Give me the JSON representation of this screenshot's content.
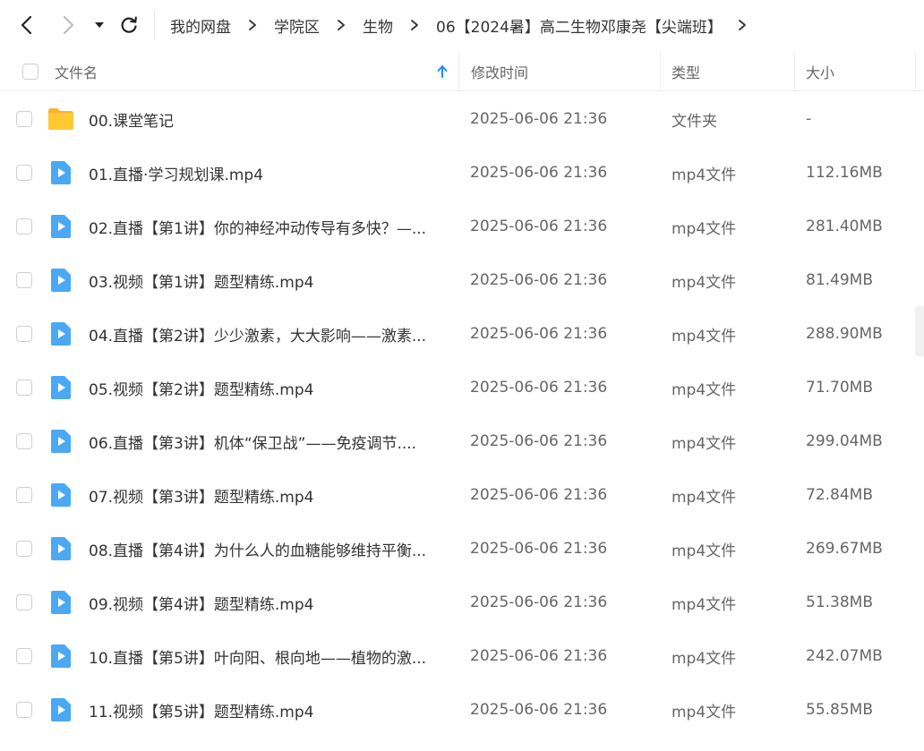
{
  "nav": {
    "back_icon": "chevron-left-icon",
    "forward_icon": "chevron-right-icon",
    "dropdown_icon": "caret-down-icon",
    "refresh_icon": "refresh-icon"
  },
  "breadcrumb": [
    "我的网盘",
    "学院区",
    "生物",
    "06【2024暑】高二生物邓康尧【尖端班】"
  ],
  "columns": {
    "name": "文件名",
    "mtime": "修改时间",
    "type": "类型",
    "size": "大小"
  },
  "sort_indicator_icon": "arrow-up-icon",
  "colors": {
    "accent": "#1a8cff",
    "folder": "#ffc933",
    "video_icon": "#4aa8f5"
  },
  "files": [
    {
      "icon": "folder-icon",
      "name": "00.课堂笔记",
      "mtime": "2025-06-06 21:36",
      "type": "文件夹",
      "size": "-"
    },
    {
      "icon": "video-file-icon",
      "name": "01.直播·学习规划课.mp4",
      "mtime": "2025-06-06 21:36",
      "type": "mp4文件",
      "size": "112.16MB"
    },
    {
      "icon": "video-file-icon",
      "name": "02.直播【第1讲】你的神经冲动传导有多快？—...",
      "mtime": "2025-06-06 21:36",
      "type": "mp4文件",
      "size": "281.40MB"
    },
    {
      "icon": "video-file-icon",
      "name": "03.视频【第1讲】题型精练.mp4",
      "mtime": "2025-06-06 21:36",
      "type": "mp4文件",
      "size": "81.49MB"
    },
    {
      "icon": "video-file-icon",
      "name": "04.直播【第2讲】少少激素，大大影响——激素...",
      "mtime": "2025-06-06 21:36",
      "type": "mp4文件",
      "size": "288.90MB"
    },
    {
      "icon": "video-file-icon",
      "name": "05.视频【第2讲】题型精练.mp4",
      "mtime": "2025-06-06 21:36",
      "type": "mp4文件",
      "size": "71.70MB"
    },
    {
      "icon": "video-file-icon",
      "name": "06.直播【第3讲】机体“保卫战”——免疫调节....",
      "mtime": "2025-06-06 21:36",
      "type": "mp4文件",
      "size": "299.04MB"
    },
    {
      "icon": "video-file-icon",
      "name": "07.视频【第3讲】题型精练.mp4",
      "mtime": "2025-06-06 21:36",
      "type": "mp4文件",
      "size": "72.84MB"
    },
    {
      "icon": "video-file-icon",
      "name": "08.直播【第4讲】为什么人的血糖能够维持平衡...",
      "mtime": "2025-06-06 21:36",
      "type": "mp4文件",
      "size": "269.67MB"
    },
    {
      "icon": "video-file-icon",
      "name": "09.视频【第4讲】题型精练.mp4",
      "mtime": "2025-06-06 21:36",
      "type": "mp4文件",
      "size": "51.38MB"
    },
    {
      "icon": "video-file-icon",
      "name": "10.直播【第5讲】叶向阳、根向地——植物的激...",
      "mtime": "2025-06-06 21:36",
      "type": "mp4文件",
      "size": "242.07MB"
    },
    {
      "icon": "video-file-icon",
      "name": "11.视频【第5讲】题型精练.mp4",
      "mtime": "2025-06-06 21:36",
      "type": "mp4文件",
      "size": "55.85MB"
    }
  ]
}
